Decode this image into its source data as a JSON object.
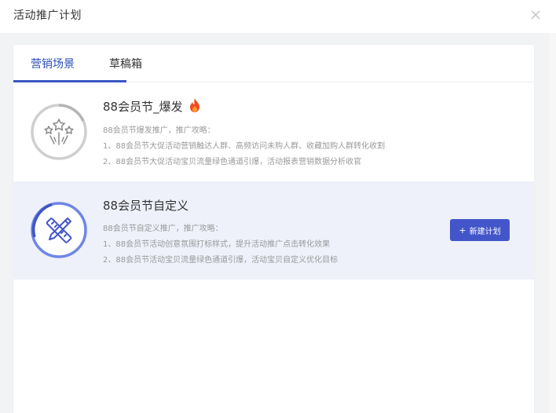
{
  "dialog": {
    "title": "活动推广计划",
    "close_icon": "close-icon"
  },
  "tabs": [
    {
      "label": "营销场景",
      "active": true
    },
    {
      "label": "草稿箱",
      "active": false
    }
  ],
  "scenes": [
    {
      "title": "88会员节_爆发",
      "badge_icon": "fire-icon",
      "icon": "fireworks-icon",
      "desc_heading": "88会员节爆发推广，推广攻略：",
      "desc_lines": [
        "1、88会员节大促活动营销触达人群、高频访问未购人群、收藏加购人群转化收割",
        "2、88会员节大促活动宝贝流量绿色通道引爆，活动报表营销数据分析收官"
      ]
    },
    {
      "title": "88会员节自定义",
      "icon": "pencil-ruler-icon",
      "desc_heading": "88会员节自定义推广，推广攻略：",
      "desc_lines": [
        "1、88会员节活动创意氛围打标样式，提升活动推广点击转化效果",
        "2、88会员节活动宝贝流量绿色通道引爆，活动宝贝自定义优化目标"
      ],
      "action_label": "新建计划",
      "action_plus": "+"
    }
  ],
  "colors": {
    "accent": "#4356c9",
    "tab_active_text": "#2e4fb8",
    "selected_row_bg": "#eef1fa",
    "fire": "#f04a1f"
  }
}
